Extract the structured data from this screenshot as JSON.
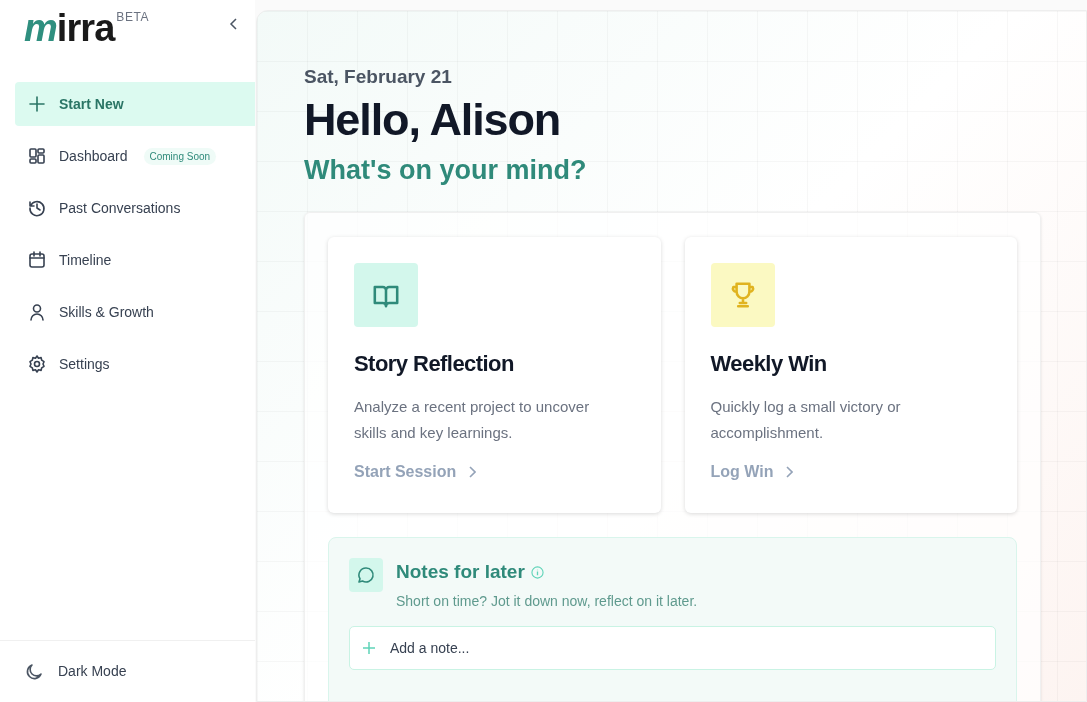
{
  "sidebar": {
    "logo": "mirra",
    "badge": "BETA",
    "items": [
      {
        "kind": "plus",
        "label": "Start New",
        "selected": true
      },
      {
        "kind": "grid",
        "label": "Dashboard",
        "selected": false,
        "tag": "Coming Soon"
      },
      {
        "kind": "history",
        "label": "Past Conversations",
        "selected": false
      },
      {
        "kind": "calendar",
        "label": "Timeline",
        "selected": false
      },
      {
        "kind": "user",
        "label": "Skills & Growth",
        "selected": false
      },
      {
        "kind": "gear",
        "label": "Settings",
        "selected": false
      }
    ],
    "footer": {
      "kind": "moon",
      "label": "Dark Mode"
    }
  },
  "header": {
    "date": "Sat, February 21",
    "greeting": "Hello, Alison",
    "prompt": "What's on your mind?"
  },
  "cards": [
    {
      "kind": "book",
      "title": "Story Reflection",
      "description": "Analyze a recent project to uncover skills and key learnings.",
      "action": "Start Session"
    },
    {
      "kind": "trophy",
      "title": "Weekly Win",
      "description": "Quickly log a small victory or accomplishment.",
      "action": "Log Win"
    }
  ],
  "notes": {
    "title": "Notes for later",
    "subtitle": "Short on time? Jot it down now, reflect on it later.",
    "placeholder": "Add a note..."
  }
}
